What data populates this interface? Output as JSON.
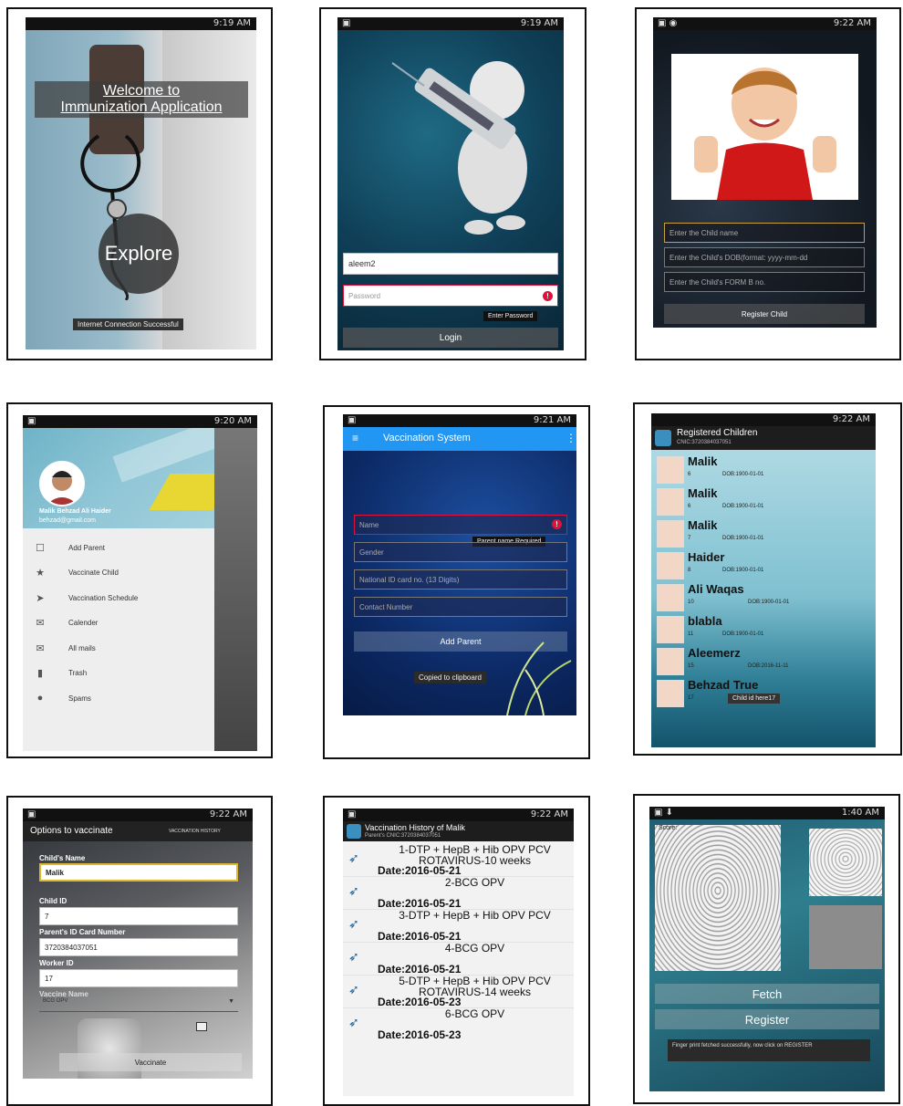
{
  "screens": {
    "welcome": {
      "status_time": "9:19 AM",
      "title_line1": "Welcome to",
      "title_line2": "Immunization Application",
      "explore_label": "Explore",
      "toast": "Internet Connection Successful"
    },
    "login": {
      "status_time": "9:19 AM",
      "username_value": "aleem2",
      "password_placeholder": "Password",
      "error_tooltip": "Enter Password",
      "login_label": "Login"
    },
    "register_child": {
      "status_time": "9:22 AM",
      "name_placeholder": "Enter the Child name",
      "dob_placeholder": "Enter the Child's DOB(format: yyyy-mm-dd",
      "formb_placeholder": "Enter the Child's FORM B no.",
      "register_label": "Register Child"
    },
    "drawer": {
      "status_time": "9:20 AM",
      "user_name": "Malik Behzad Ali Haider",
      "user_email": "behzad@gmail.com",
      "items": [
        {
          "icon": "person-icon",
          "glyph": "☐",
          "label": "Add Parent"
        },
        {
          "icon": "star-icon",
          "glyph": "★",
          "label": "Vaccinate Child"
        },
        {
          "icon": "send-icon",
          "glyph": "➤",
          "label": "Vaccination Schedule"
        },
        {
          "icon": "inbox-icon",
          "glyph": "✉",
          "label": "Calender"
        },
        {
          "icon": "mail-icon",
          "glyph": "✉",
          "label": "All mails"
        },
        {
          "icon": "trash-icon",
          "glyph": "▮",
          "label": "Trash"
        },
        {
          "icon": "alert-icon",
          "glyph": "●",
          "label": "Spams"
        }
      ]
    },
    "add_parent": {
      "status_time": "9:21 AM",
      "app_title": "Vaccination System",
      "name_placeholder": "Name",
      "name_error": "Parent name Required",
      "gender_placeholder": "Gender",
      "cnic_placeholder": "National ID card no. (13 Digits)",
      "contact_placeholder": "Contact Number",
      "add_label": "Add Parent",
      "toast": "Copied to clipboard"
    },
    "children": {
      "status_time": "9:22 AM",
      "title": "Registered Children",
      "subtitle": "CNIC:3720384037051",
      "rows": [
        {
          "name": "Malik",
          "id": "6",
          "dob": "DOB:1900-01-01"
        },
        {
          "name": "Malik",
          "id": "6",
          "dob": "DOB:1900-01-01"
        },
        {
          "name": "Malik",
          "id": "7",
          "dob": "DOB:1900-01-01"
        },
        {
          "name": "Haider",
          "id": "8",
          "dob": "DOB:1900-01-01"
        },
        {
          "name": "Ali Waqas",
          "id": "10",
          "dob": "DOB:1900-01-01"
        },
        {
          "name": "blabla",
          "id": "11",
          "dob": "DOB:1900-01-01"
        },
        {
          "name": "Aleemerz",
          "id": "15",
          "dob": "DOB:2016-11-11"
        },
        {
          "name": "Behzad True",
          "id": "17",
          "dob": ""
        }
      ],
      "toast": "Child id here17"
    },
    "vaccinate": {
      "status_time": "9:22 AM",
      "title": "Options to vaccinate",
      "menu": "VACCINATION HISTORY",
      "child_name_label": "Child's Name",
      "child_name_value": "Malik",
      "child_id_label": "Child ID",
      "child_id_value": "7",
      "parent_id_label": "Parent's ID Card Number",
      "parent_id_value": "3720384037051",
      "worker_id_label": "Worker ID",
      "worker_id_value": "17",
      "vaccine_label": "Vaccine Name",
      "vaccine_value": "BCG OPV",
      "vaccinate_label": "Vaccinate"
    },
    "history": {
      "status_time": "9:22 AM",
      "title": "Vaccination History of Malik",
      "subtitle": "Parent's CNIC:3720384037051",
      "rows": [
        {
          "vaccine": "1-DTP + HepB + Hib  OPV  PCV ROTAVIRUS-10 weeks",
          "date": "Date:2016-05-21"
        },
        {
          "vaccine": "2-BCG  OPV",
          "date": "Date:2016-05-21"
        },
        {
          "vaccine": "3-DTP + HepB + Hib  OPV  PCV",
          "date": "Date:2016-05-21"
        },
        {
          "vaccine": "4-BCG  OPV",
          "date": "Date:2016-05-21"
        },
        {
          "vaccine": "5-DTP + HepB + Hib  OPV  PCV ROTAVIRUS-14 weeks",
          "date": "Date:2016-05-23"
        },
        {
          "vaccine": "6-BCG  OPV",
          "date": "Date:2016-05-23"
        }
      ]
    },
    "fingerprint": {
      "status_time": "1:40 AM",
      "score_label": "Score:",
      "fetch_label": "Fetch",
      "register_label": "Register",
      "toast": "Finger print fetched successfully, now click on REGISTER"
    }
  }
}
